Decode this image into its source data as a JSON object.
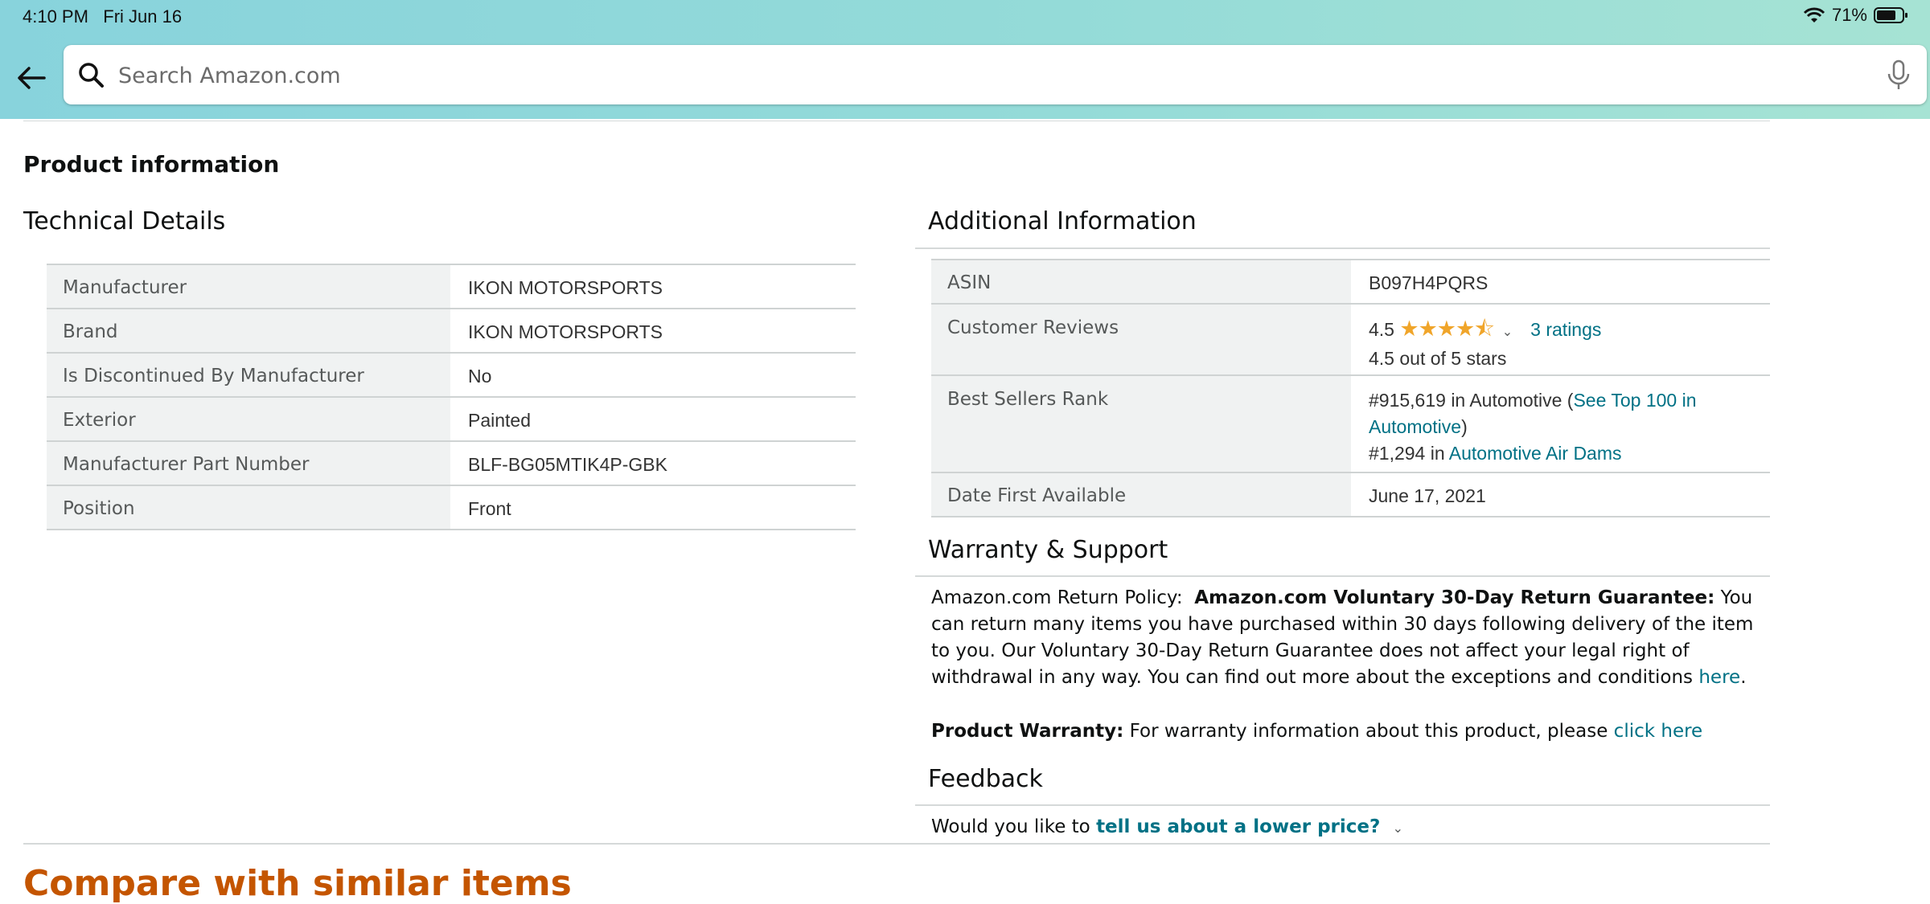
{
  "status_bar": {
    "time": "4:10 PM",
    "date": "Fri Jun 16",
    "battery": "71%"
  },
  "search": {
    "placeholder": "Search Amazon.com"
  },
  "product_information": {
    "title": "Product information",
    "technical_details": {
      "heading": "Technical Details",
      "rows": [
        {
          "label": "Manufacturer",
          "value": "IKON MOTORSPORTS"
        },
        {
          "label": "Brand",
          "value": "IKON MOTORSPORTS"
        },
        {
          "label": "Is Discontinued By Manufacturer",
          "value": "No"
        },
        {
          "label": "Exterior",
          "value": "Painted"
        },
        {
          "label": "Manufacturer Part Number",
          "value": "BLF-BG05MTIK4P-GBK"
        },
        {
          "label": "Position",
          "value": "Front"
        }
      ]
    },
    "additional_information": {
      "heading": "Additional Information",
      "asin": {
        "label": "ASIN",
        "value": "B097H4PQRS"
      },
      "customer_reviews": {
        "label": "Customer Reviews",
        "rating": "4.5",
        "stars": 4.5,
        "ratings_link": "3 ratings",
        "out_of": "4.5 out of 5 stars"
      },
      "best_sellers_rank": {
        "label": "Best Sellers Rank",
        "line1_prefix": "#915,619 in Automotive (",
        "line1_link": "See Top 100 in Automotive",
        "line1_suffix": ")",
        "line2_prefix": "#1,294 in ",
        "line2_link": "Automotive Air Dams"
      },
      "date_first_available": {
        "label": "Date First Available",
        "value": "June 17, 2021"
      }
    },
    "warranty_support": {
      "heading": "Warranty & Support",
      "policy_label": "Amazon.com Return Policy:",
      "policy_bold": "Amazon.com Voluntary 30-Day Return Guarantee:",
      "policy_text": "You can return many items you have purchased within 30 days following delivery of the item to you. Our Voluntary 30-Day Return Guarantee does not affect your legal right of withdrawal in any way. You can find out more about the exceptions and conditions",
      "policy_link": "here",
      "policy_end": ".",
      "warranty_bold": "Product Warranty:",
      "warranty_text": "For warranty information about this product, please",
      "warranty_link": "click here"
    },
    "feedback": {
      "heading": "Feedback",
      "prompt": "Would you like to",
      "link": "tell us about a lower price?"
    }
  },
  "next_section": {
    "heading": "Compare with similar items"
  },
  "colors": {
    "link": "#007185",
    "star": "#f0a52a",
    "key_bg": "#f0f2f2",
    "next_heading": "#c45500"
  }
}
